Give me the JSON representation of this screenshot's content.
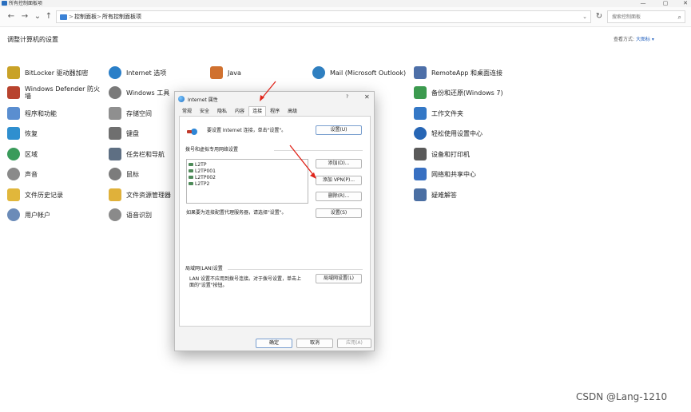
{
  "window": {
    "title": "所有控制面板项",
    "minimize": "—",
    "maximize": "▢",
    "close": "✕"
  },
  "address": {
    "back": "←",
    "forward": "→",
    "recent": "⌄",
    "up": "↑",
    "crumbs": [
      "控制面板",
      "所有控制面板项"
    ],
    "separators": [
      ">",
      ">"
    ],
    "dropdown": "⌄",
    "refresh": "↻",
    "search_placeholder": "搜索控制面板",
    "search_icon": "⌕"
  },
  "page": {
    "heading": "调整计算机的设置",
    "view_by_label": "查看方式:",
    "view_by_value": "大图标 ▾"
  },
  "items": [
    {
      "label": "BitLocker 驱动器加密",
      "icon": "bitlocker-key-icon",
      "color": "#c9a227"
    },
    {
      "label": "Windows Defender 防火墙",
      "icon": "firewall-icon",
      "color": "#b8432e"
    },
    {
      "label": "程序和功能",
      "icon": "programs-icon",
      "color": "#5a8ed0"
    },
    {
      "label": "恢复",
      "icon": "recovery-icon",
      "color": "#2f8fcf"
    },
    {
      "label": "区域",
      "icon": "region-globe-icon",
      "color": "#3a9b5b"
    },
    {
      "label": "声音",
      "icon": "speaker-icon",
      "color": "#8a8a8a"
    },
    {
      "label": "文件历史记录",
      "icon": "file-history-icon",
      "color": "#e1b73b"
    },
    {
      "label": "用户帐户",
      "icon": "user-accounts-icon",
      "color": "#6b8bb8"
    },
    {
      "label": "Internet 选项",
      "icon": "internet-options-icon",
      "color": "#2a7fc8"
    },
    {
      "label": "Windows 工具",
      "icon": "windows-tools-icon",
      "color": "#7a7a7a"
    },
    {
      "label": "存储空间",
      "icon": "storage-spaces-icon",
      "color": "#8f8f8f"
    },
    {
      "label": "键盘",
      "icon": "keyboard-icon",
      "color": "#6f6f6f"
    },
    {
      "label": "任务栏和导航",
      "icon": "taskbar-icon",
      "color": "#5e6f83"
    },
    {
      "label": "鼠标",
      "icon": "mouse-icon",
      "color": "#7c7c7c"
    },
    {
      "label": "文件资源管理器",
      "icon": "file-explorer-icon",
      "color": "#e0b13a"
    },
    {
      "label": "语音识别",
      "icon": "microphone-icon",
      "color": "#8a8a8a"
    },
    {
      "label": "Java",
      "icon": "java-icon",
      "color": "#d0712f"
    },
    {
      "label": "Mail (Microsoft Outlook)",
      "icon": "mail-icon",
      "color": "#2f7fc0"
    },
    {
      "label": "RemoteApp 和桌面连接",
      "icon": "remote-desktop-icon",
      "color": "#4d6fa8"
    },
    {
      "label": "备份和还原(Windows 7)",
      "icon": "backup-icon",
      "color": "#3c9a4f"
    },
    {
      "label": "工作文件夹",
      "icon": "work-folders-icon",
      "color": "#3478c6"
    },
    {
      "label": "轻松使用设置中心",
      "icon": "ease-of-access-icon",
      "color": "#2766b5"
    },
    {
      "label": "设备和打印机",
      "icon": "printer-icon",
      "color": "#5a5a5a"
    },
    {
      "label": "网络和共享中心",
      "icon": "network-icon",
      "color": "#3870c2"
    },
    {
      "label": "疑难解答",
      "icon": "troubleshoot-icon",
      "color": "#4b6fa3"
    }
  ],
  "dialog": {
    "title": "Internet 属性",
    "help": "?",
    "close": "✕",
    "tabs": [
      "常规",
      "安全",
      "隐私",
      "内容",
      "连接",
      "程序",
      "高级"
    ],
    "active_tab": 4,
    "setup_text": "要设置 Internet 连接，单击\"设置\"。",
    "setup_button": "设置(U)",
    "dialup_group": "拨号和虚拟专用网络设置",
    "vpn_connections": [
      "L2TP",
      "L2TP001",
      "L2TP002",
      "L2TP2"
    ],
    "add_button": "添加(D)...",
    "add_vpn_button": "添加 VPN(P)...",
    "remove_button": "删除(R)...",
    "proxy_text": "如果要为连接配置代理服务器，请选择\"设置\"。",
    "settings_button": "设置(S)",
    "lan_group": "局域网(LAN)设置",
    "lan_text_1": "LAN 设置不应用到拨号连接。对于拨号设置，单击上",
    "lan_text_2": "面的\"设置\"按钮。",
    "lan_button": "局域网设置(L)",
    "ok_button": "确定",
    "cancel_button": "取消",
    "apply_button": "应用(A)"
  },
  "watermark": "CSDN @Lang-1210",
  "annotation_color": "#e0251b"
}
